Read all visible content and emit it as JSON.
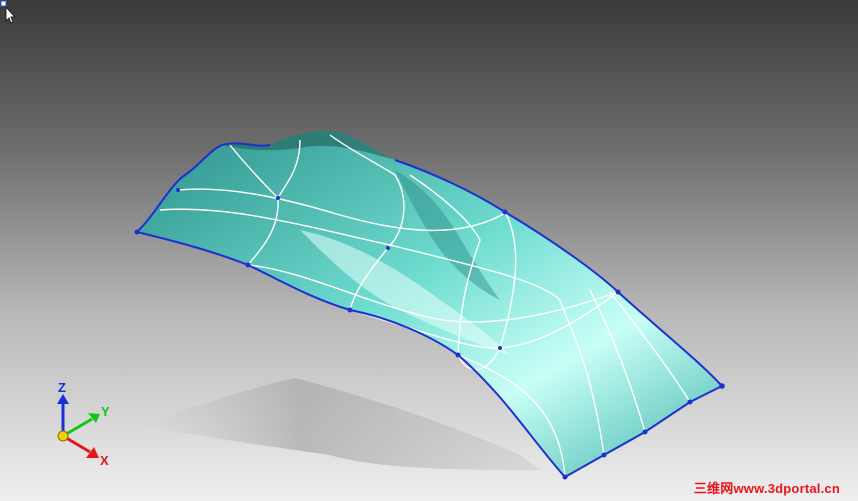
{
  "viewport": {
    "background_top": "#3a3a3a",
    "background_bottom": "#efefef"
  },
  "model": {
    "surface_color": "#5fcfc4",
    "boundary_color": "#1f2fd0",
    "isoparm_color": "#ffffff"
  },
  "triad": {
    "z_label": "Z",
    "y_label": "Y",
    "x_label": "X",
    "z_color": "#1a2fd6",
    "y_color": "#18c418",
    "x_color": "#e01818",
    "origin_color": "#f0d000"
  },
  "cursor": {
    "icon": "arrow-cursor-icon"
  },
  "watermark": {
    "text": "三维网www.3dportal.cn",
    "color": "#e8141c"
  }
}
